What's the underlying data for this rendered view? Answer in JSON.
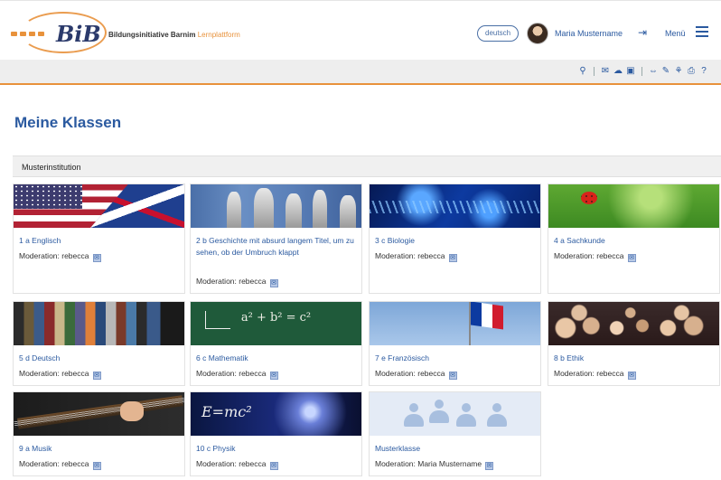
{
  "header": {
    "logo_text": "BiB",
    "org_name": "Bildungsinitiative Barnim",
    "org_suffix": "Lernplattform",
    "language_button": "deutsch",
    "user_name": "Maria Mustername",
    "menu_label": "Menü"
  },
  "page": {
    "title": "Meine Klassen",
    "institution": "Musterinstitution"
  },
  "classes": [
    {
      "title": "1 a Englisch",
      "moderation": "Moderation: rebecca"
    },
    {
      "title": "2 b Geschichte mit absurd langem Titel, um zu sehen, ob der Umbruch klappt",
      "moderation": "Moderation: rebecca"
    },
    {
      "title": "3 c Biologie",
      "moderation": "Moderation: rebecca"
    },
    {
      "title": "4 a Sachkunde",
      "moderation": "Moderation: rebecca"
    },
    {
      "title": "5 d Deutsch",
      "moderation": "Moderation: rebecca"
    },
    {
      "title": "6 c Mathematik",
      "moderation": "Moderation: rebecca"
    },
    {
      "title": "7 e Französisch",
      "moderation": "Moderation: rebecca"
    },
    {
      "title": "8 b Ethik",
      "moderation": "Moderation: rebecca"
    },
    {
      "title": "9 a Musik",
      "moderation": "Moderation: rebecca"
    },
    {
      "title": "10 c Physik",
      "moderation": "Moderation: rebecca"
    },
    {
      "title": "Musterklasse",
      "moderation": "Moderation: Maria Mustername"
    }
  ],
  "images": {
    "math_formula": "a² + b² = c²",
    "physics_formula": "E=mc²"
  },
  "colors": {
    "accent": "#e8923c",
    "link": "#2b5aa0"
  }
}
